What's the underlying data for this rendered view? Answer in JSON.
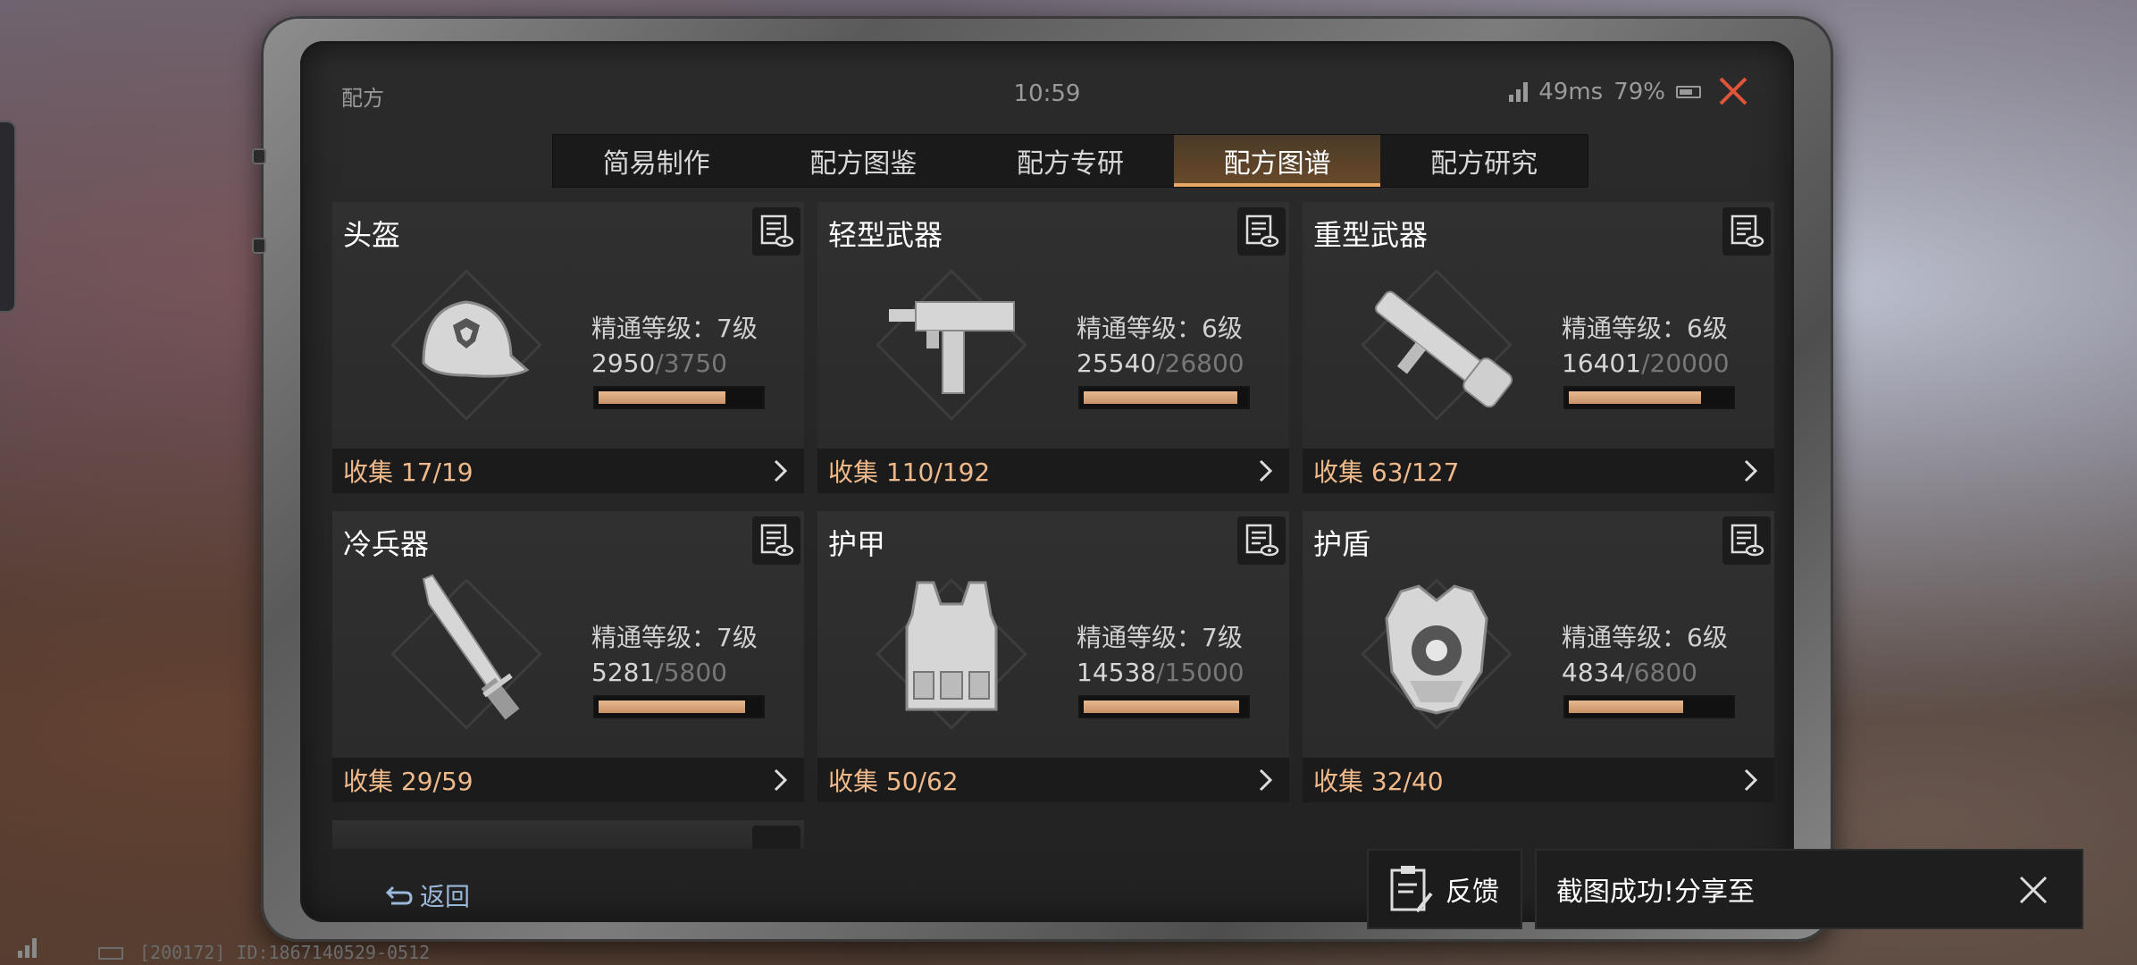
{
  "status": {
    "app_title": "配方",
    "time": "10:59",
    "ping": "49ms",
    "battery": "79%"
  },
  "tabs": [
    {
      "label": "简易制作",
      "active": false
    },
    {
      "label": "配方图鉴",
      "active": false
    },
    {
      "label": "配方专研",
      "active": false
    },
    {
      "label": "配方图谱",
      "active": true
    },
    {
      "label": "配方研究",
      "active": false
    }
  ],
  "cards": [
    {
      "title": "头盔",
      "mastery": "精通等级：7级",
      "current": "2950",
      "max": "/3750",
      "fill": 0.787,
      "collect": "收集 17/19",
      "icon": "helmet-cap-icon"
    },
    {
      "title": "轻型武器",
      "mastery": "精通等级：6级",
      "current": "25540",
      "max": "/26800",
      "fill": 0.953,
      "collect": "收集 110/192",
      "icon": "submachine-gun-icon"
    },
    {
      "title": "重型武器",
      "mastery": "精通等级：6级",
      "current": "16401",
      "max": "/20000",
      "fill": 0.82,
      "collect": "收集 63/127",
      "icon": "rocket-launcher-icon"
    },
    {
      "title": "冷兵器",
      "mastery": "精通等级：7级",
      "current": "5281",
      "max": "/5800",
      "fill": 0.91,
      "collect": "收集 29/59",
      "icon": "machete-icon"
    },
    {
      "title": "护甲",
      "mastery": "精通等级：7级",
      "current": "14538",
      "max": "/15000",
      "fill": 0.969,
      "collect": "收集 50/62",
      "icon": "body-armor-icon"
    },
    {
      "title": "护盾",
      "mastery": "精通等级：6级",
      "current": "4834",
      "max": "/6800",
      "fill": 0.711,
      "collect": "收集 32/40",
      "icon": "shield-vest-icon"
    }
  ],
  "back_label": "返回",
  "feedback_label": "反馈",
  "toast_text": "截图成功!分享至",
  "device_id": "[200172] ID:1867140529-0512",
  "colors": {
    "accent": "#e9a867",
    "collect_text": "#f0b98a",
    "bar_fill": "#d9a47a"
  }
}
